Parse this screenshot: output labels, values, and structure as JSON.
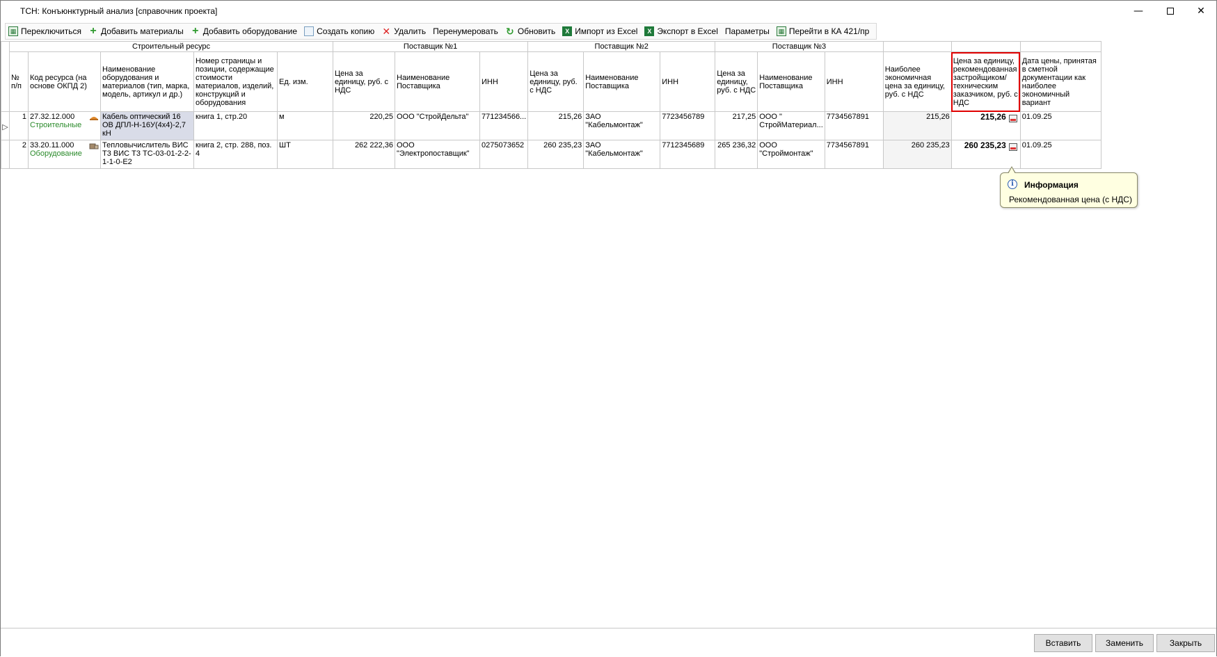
{
  "window": {
    "title": "ТСН: Конъюнктурный анализ [справочник проекта]"
  },
  "toolbar": {
    "switch": "Переключиться",
    "add_materials": "Добавить материалы",
    "add_equipment": "Добавить оборудование",
    "create_copy": "Создать копию",
    "delete": "Удалить",
    "renumber": "Перенумеровать",
    "refresh": "Обновить",
    "import_excel": "Импорт из Excel",
    "export_excel": "Экспорт в Excel",
    "parameters": "Параметры",
    "goto_ka": "Перейти в КА 421/пр"
  },
  "table": {
    "groups": {
      "resource": "Строительный ресурс",
      "supplier1": "Поставщик №1",
      "supplier2": "Поставщик №2",
      "supplier3": "Поставщик №3"
    },
    "headers": {
      "num": "№ п/п",
      "code": "Код ресурса (на основе ОКПД 2)",
      "name": "Наименование оборудования и материалов (тип, марка, модель, артикул и др.)",
      "page": "Номер страницы и позиции, содержащие стоимости материалов, изделий, конструкций и оборудования",
      "unit": "Ед. изм.",
      "price": "Цена за единицу, руб. с НДС",
      "supplier_name": "Наименование Поставщика",
      "inn": "ИНН",
      "price_short": "Цена за единицу, руб. с НДС",
      "economical": "Наиболее экономичная цена за единицу, руб. с НДС",
      "recommended": "Цена за единицу, рекомендованная застройщиком/ техническим заказчиком, руб. с НДС",
      "date": "Дата цены, принятая в сметной документации как наиболее экономичный вариант"
    },
    "rows": [
      {
        "num": "1",
        "code": "27.32.12.000",
        "category": "Строительные",
        "name": "Кабель оптический 16 ОВ ДПЛ-Н-16У(4x4)-2,7 кН",
        "page": "книга 1, стр.20",
        "unit": "м",
        "s1_price": "220,25",
        "s1_name": "ООО \"СтройДельта\"",
        "s1_inn": "771234566...",
        "s2_price": "215,26",
        "s2_name": "ЗАО \"Кабельмонтаж\"",
        "s2_inn": "7723456789",
        "s3_price": "217,25",
        "s3_name": "ООО \" СтройМатериал...",
        "s3_inn": "7734567891",
        "economical": "215,26",
        "recommended": "215,26",
        "date": "01.09.25"
      },
      {
        "num": "2",
        "code": "33.20.11.000",
        "category": "Оборудование",
        "name": "Тепловычислитель ВИС Т3 ВИС Т3 ТС-03-01-2-2-1-1-0-Е2",
        "page": "книга 2, стр. 288, поз. 4",
        "unit": "ШТ",
        "s1_price": "262 222,36",
        "s1_name": "ООО \"Электропоставщик\"",
        "s1_inn": "0275073652",
        "s2_price": "260 235,23",
        "s2_name": "ЗАО \"Кабельмонтаж\"",
        "s2_inn": "7712345689",
        "s3_price": "265 236,32",
        "s3_name": "ООО \"Строймонтаж\"",
        "s3_inn": "7734567891",
        "economical": "260 235,23",
        "recommended": "260 235,23",
        "date": "01.09.25"
      }
    ]
  },
  "tooltip": {
    "title": "Информация",
    "text": "Рекомендованная цена (с НДС)"
  },
  "buttons": {
    "insert": "Вставить",
    "replace": "Заменить",
    "close": "Закрыть"
  },
  "colors": {
    "category_green": "#2a8a2a",
    "highlight_red": "#e00000",
    "tooltip_bg": "#ffffe1"
  }
}
